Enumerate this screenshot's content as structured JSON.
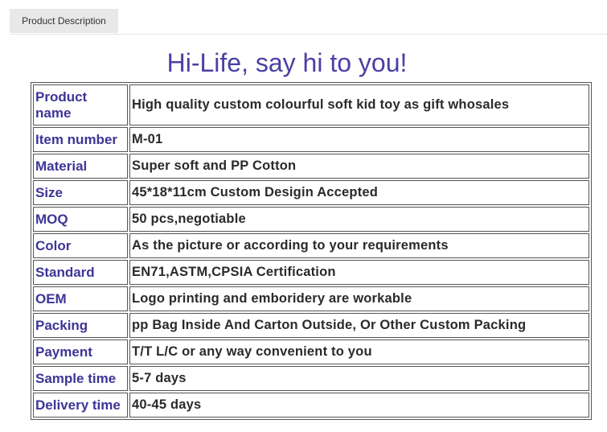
{
  "tabs": [
    {
      "label": "Product Description"
    }
  ],
  "headline": "Hi-Life, say hi to you!",
  "specs": [
    {
      "label": "Product name",
      "value": "High quality custom colourful soft kid toy as gift whosales"
    },
    {
      "label": "Item number",
      "value": "M-01"
    },
    {
      "label": "Material",
      "value": "Super soft and PP Cotton"
    },
    {
      "label": "Size",
      "value": "45*18*11cm Custom Desigin Accepted"
    },
    {
      "label": "MOQ",
      "value": "50 pcs,negotiable"
    },
    {
      "label": "Color",
      "value": "As the picture or according to your requirements"
    },
    {
      "label": "Standard",
      "value": "EN71,ASTM,CPSIA Certification"
    },
    {
      "label": "OEM",
      "value": "Logo printing and emboridery are workable"
    },
    {
      "label": "Packing",
      "value": "pp Bag Inside And Carton Outside, Or Other Custom Packing"
    },
    {
      "label": "Payment",
      "value": "T/T L/C or any way convenient to you"
    },
    {
      "label": "Sample time",
      "value": "5-7 days"
    },
    {
      "label": "Delivery time",
      "value": "40-45 days"
    }
  ],
  "colors": {
    "label_text": "#3d3596",
    "headline": "#4b3fa3",
    "tab_background": "#e8e8e8"
  }
}
